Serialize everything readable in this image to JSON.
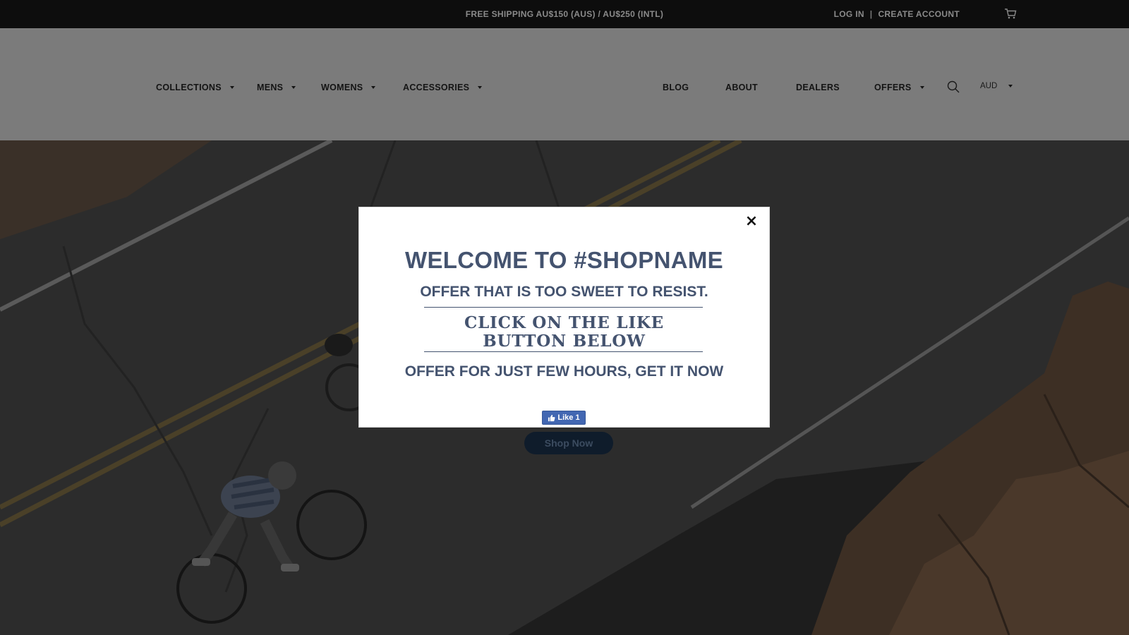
{
  "topbar": {
    "shipping": "FREE SHIPPING AU$150 (AUS) / AU$250 (INTL)",
    "login": "LOG IN",
    "separator": "|",
    "create_account": "CREATE ACCOUNT",
    "cart_icon": "cart-icon"
  },
  "nav": {
    "left": [
      {
        "label": "COLLECTIONS",
        "dropdown": true
      },
      {
        "label": "MENS",
        "dropdown": true
      },
      {
        "label": "WOMENS",
        "dropdown": true
      },
      {
        "label": "ACCESSORIES",
        "dropdown": true
      }
    ],
    "right": [
      {
        "label": "BLOG",
        "dropdown": false
      },
      {
        "label": "ABOUT",
        "dropdown": false
      },
      {
        "label": "DEALERS",
        "dropdown": false
      },
      {
        "label": "OFFERS",
        "dropdown": true
      }
    ],
    "search_icon": "search-icon",
    "currency": "AUD"
  },
  "hero": {
    "shop_now": "Shop Now"
  },
  "popup": {
    "title": "WELCOME TO #SHOPNAME",
    "subtitle": "OFFER THAT IS TOO SWEET TO RESIST.",
    "cta_line1": "CLICK ON THE LIKE",
    "cta_line2": "BUTTON BELOW",
    "hours": "OFFER FOR JUST FEW HOURS, GET IT NOW",
    "like_label": "Like 1",
    "close_symbol": "×"
  },
  "colors": {
    "popup_text": "#44536f",
    "like_button": "#4267b2",
    "topbar_bg": "#0d0d0d",
    "header_bg": "#7b7b7b"
  }
}
